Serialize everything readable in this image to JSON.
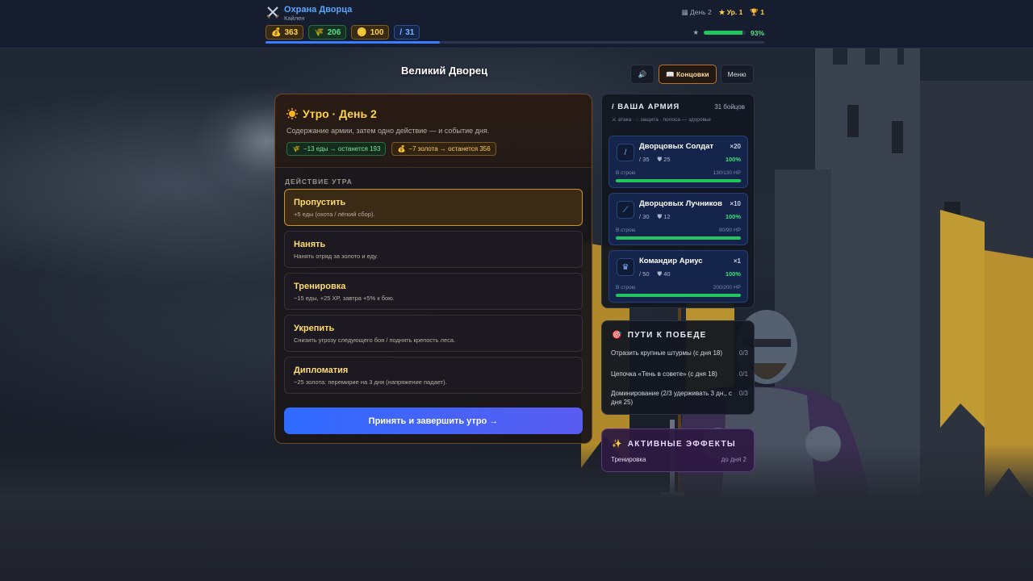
{
  "header": {
    "title": "Охрана Дворца",
    "subtitle": "Кайлен",
    "day": "День 2",
    "level": "Ур. 1",
    "trophies": "1",
    "resources": {
      "gold": "363",
      "food": "206",
      "coins": "100",
      "power": "31"
    },
    "day_progress": 0.35,
    "health_pct": "93%",
    "health_value": 0.93
  },
  "page_title": "Великий Дворец",
  "buttons": {
    "sound": "🔊",
    "endings": "Концовки",
    "menu": "Меню"
  },
  "morning": {
    "title": "Утро · День 2",
    "description": "Содержание армии, затем одно действие — и событие дня.",
    "food_chip": "−13 еды → останется 193",
    "gold_chip": "−7 золота → останется 356",
    "section_label": "ДЕЙСТВИЕ УТРА",
    "actions": [
      {
        "name": "Пропустить",
        "desc": "+5 еды (охота / лёгкий сбор)."
      },
      {
        "name": "Нанять",
        "desc": "Нанять отряд за золото и еду."
      },
      {
        "name": "Тренировка",
        "desc": "−15 еды, +25 XP, завтра +5% к бою."
      },
      {
        "name": "Укрепить",
        "desc": "Снизить угрозу следующего боя / поднять крепость леса."
      },
      {
        "name": "Дипломатия",
        "desc": "−25 золота: перемирие на 3 дня (напряжение падает)."
      }
    ],
    "selected_index": 0,
    "confirm_label": "Принять и завершить утро →"
  },
  "army": {
    "title": "ВАША АРМИЯ",
    "count": "31 бойцов",
    "legend": "⚔ атака · ◌ защита · полоса — здоровье",
    "units": [
      {
        "name": "Дворцовых Солдат",
        "qty": "×20",
        "attack": "35",
        "defense": "25",
        "pct": "100%",
        "formation": "В строю",
        "hp": "130/130 HP",
        "health": 1.0,
        "icon": "sword-icon"
      },
      {
        "name": "Дворцовых Лучников",
        "qty": "×10",
        "attack": "30",
        "defense": "12",
        "pct": "100%",
        "formation": "В строю",
        "hp": "90/90 HP",
        "health": 1.0,
        "icon": "bow-icon"
      },
      {
        "name": "Командир Ариус",
        "qty": "×1",
        "attack": "50",
        "defense": "40",
        "pct": "100%",
        "formation": "В строю",
        "hp": "200/200 HP",
        "health": 1.0,
        "icon": "crown-icon"
      }
    ]
  },
  "victory": {
    "title": "ПУТИ К ПОБЕДЕ",
    "paths": [
      {
        "text": "Отразить крупные штурмы (с дня 18)",
        "progress": "0/3"
      },
      {
        "text": "Цепочка «Тень в совете» (с дня 18)",
        "progress": "0/1"
      },
      {
        "text": "Доминирование (2/3 удерживать 3 дн., с дня 25)",
        "progress": "0/3"
      }
    ]
  },
  "effects": {
    "title": "АКТИВНЫЕ ЭФФЕКТЫ",
    "items": [
      {
        "name": "Тренировка",
        "until": "до дня 2"
      }
    ]
  },
  "colors": {
    "accent_blue": "#3a7bff",
    "gold": "#ffd34d",
    "health_green": "#22c55e",
    "selected_border": "#c8922e"
  }
}
